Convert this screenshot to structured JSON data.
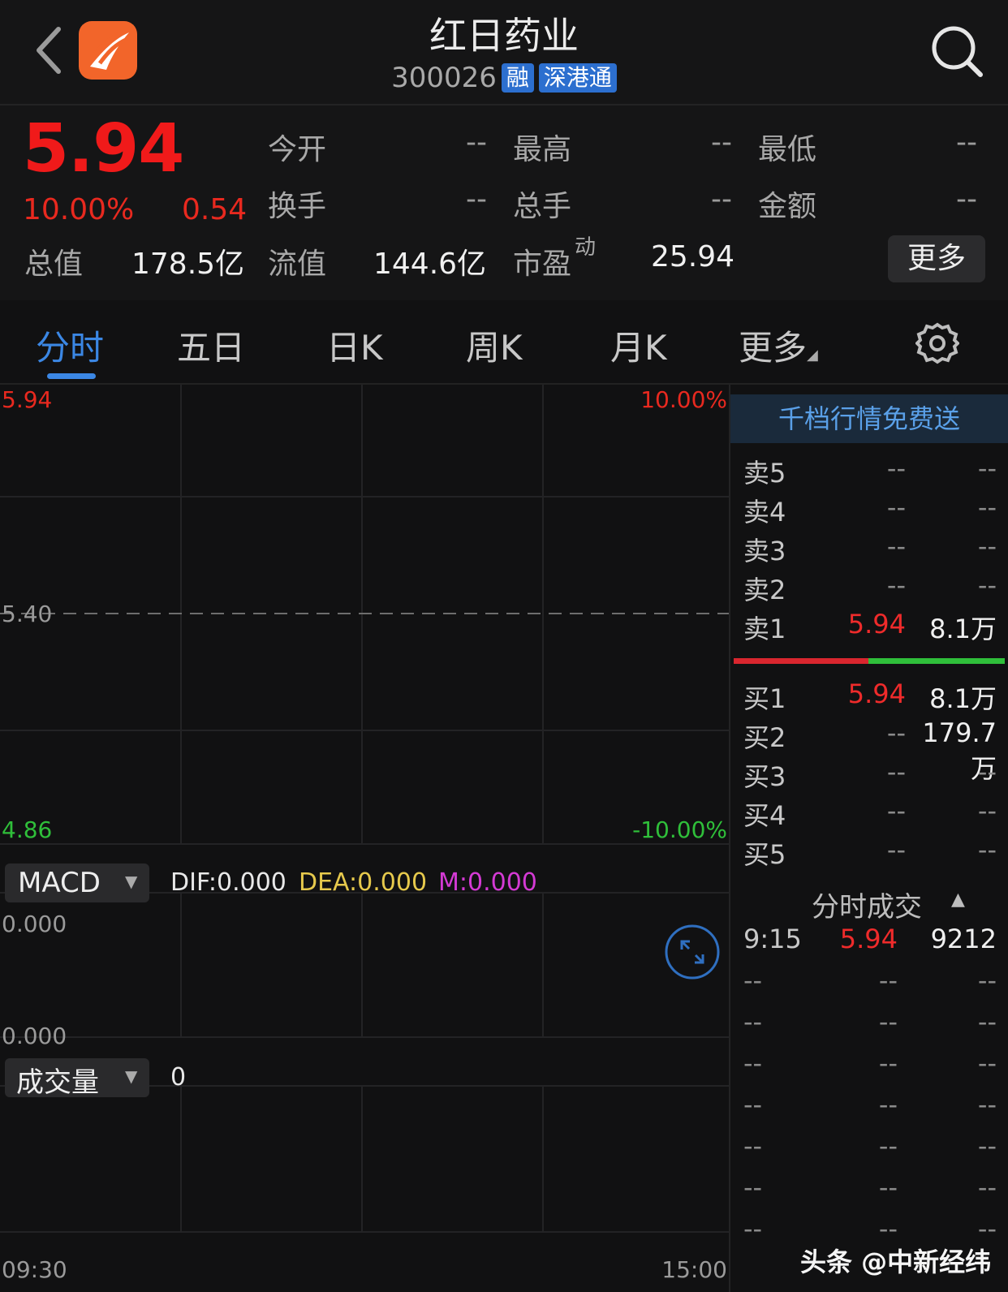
{
  "header": {
    "back_icon": "chevron-left-icon",
    "app_logo_icon": "app-logo-icon",
    "title": "红日药业",
    "code": "300026",
    "tags": [
      "融",
      "深港通"
    ],
    "search_icon": "search-icon"
  },
  "quote": {
    "price": "5.94",
    "change_pct": "10.00%",
    "change": "0.54",
    "stats": [
      {
        "label": "今开",
        "value": "--"
      },
      {
        "label": "最高",
        "value": "--"
      },
      {
        "label": "最低",
        "value": "--"
      },
      {
        "label": "换手",
        "value": "--"
      },
      {
        "label": "总手",
        "value": "--"
      },
      {
        "label": "金额",
        "value": "--"
      }
    ],
    "row3": {
      "total_label": "总值",
      "total_value": "178.5亿",
      "float_label": "流值",
      "float_value": "144.6亿",
      "pe_label": "市盈",
      "pe_sup": "动",
      "pe_value": "25.94",
      "more_label": "更多"
    },
    "colors": {
      "up": "#f01a1a",
      "down": "#2fbf3a",
      "accent": "#3b87e4"
    }
  },
  "tabs": {
    "items": [
      "分时",
      "五日",
      "日K",
      "周K",
      "月K",
      "更多"
    ],
    "active": 0,
    "settings_icon": "gear-icon"
  },
  "chart": {
    "price_top": "5.94",
    "price_mid": "5.40",
    "price_bottom": "4.86",
    "pct_top": "10.00%",
    "pct_bottom": "-10.00%",
    "macd_label": "MACD",
    "dif": "DIF:0.000",
    "dea": "DEA:0.000",
    "m": "M:0.000",
    "macd_top": "0.000",
    "macd_bottom": "0.000",
    "vol_label": "成交量",
    "vol_value": "0",
    "time_start": "09:30",
    "time_end": "15:00",
    "expand_icon": "expand-icon"
  },
  "orderbook": {
    "banner": "千档行情免费送",
    "asks": [
      {
        "label": "卖5",
        "price": "--",
        "vol": "--"
      },
      {
        "label": "卖4",
        "price": "--",
        "vol": "--"
      },
      {
        "label": "卖3",
        "price": "--",
        "vol": "--"
      },
      {
        "label": "卖2",
        "price": "--",
        "vol": "--"
      },
      {
        "label": "卖1",
        "price": "5.94",
        "vol": "8.1万"
      }
    ],
    "bids": [
      {
        "label": "买1",
        "price": "5.94",
        "vol": "8.1万"
      },
      {
        "label": "买2",
        "price": "--",
        "vol": "179.7万"
      },
      {
        "label": "买3",
        "price": "--",
        "vol": "--"
      },
      {
        "label": "买4",
        "price": "--",
        "vol": "--"
      },
      {
        "label": "买5",
        "price": "--",
        "vol": "--"
      }
    ],
    "ticks_title": "分时成交",
    "ticks": [
      {
        "time": "9:15",
        "price": "5.94",
        "vol": "9212"
      },
      {
        "time": "--",
        "price": "--",
        "vol": "--"
      },
      {
        "time": "--",
        "price": "--",
        "vol": "--"
      },
      {
        "time": "--",
        "price": "--",
        "vol": "--"
      },
      {
        "time": "--",
        "price": "--",
        "vol": "--"
      },
      {
        "time": "--",
        "price": "--",
        "vol": "--"
      },
      {
        "time": "--",
        "price": "--",
        "vol": "--"
      },
      {
        "time": "--",
        "price": "--",
        "vol": "--"
      }
    ]
  },
  "watermark": "头条 @中新经纬"
}
